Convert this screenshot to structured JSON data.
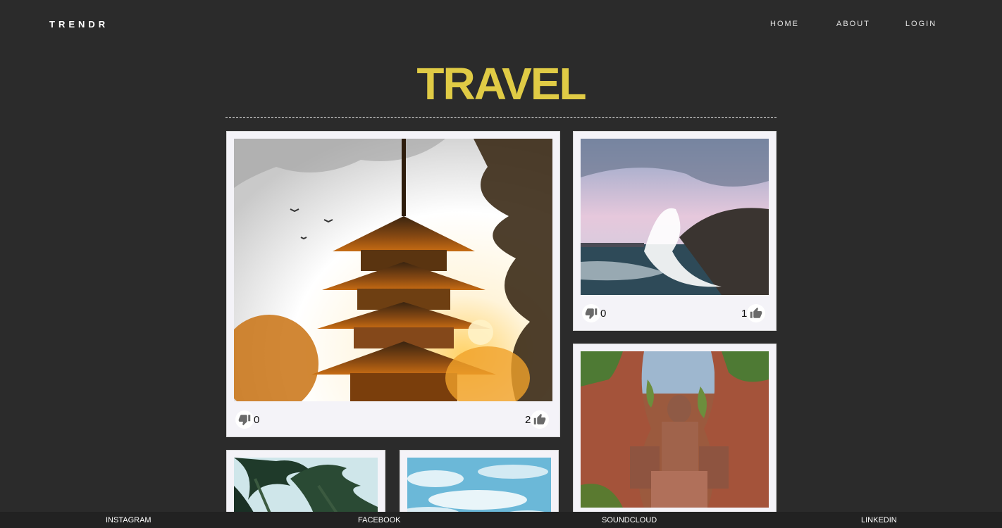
{
  "nav": {
    "brand": "TRENDR",
    "links": [
      "HOME",
      "ABOUT",
      "LOGIN"
    ]
  },
  "page": {
    "title": "TRAVEL"
  },
  "posts": [
    {
      "subject": "pagoda at sunset",
      "dislikes": "0",
      "likes": "2"
    },
    {
      "subject": "wave crashing on cliffs",
      "dislikes": "0",
      "likes": "1"
    },
    {
      "subject": "giant buddha carved in cliff"
    },
    {
      "subject": "palm trees"
    },
    {
      "subject": "blue sky with clouds"
    }
  ],
  "footer": {
    "links": [
      "INSTAGRAM",
      "FACEBOOK",
      "SOUNDCLOUD",
      "LINKEDIN"
    ]
  },
  "colors": {
    "background": "#2b2b2b",
    "accent": "#e0cb45",
    "card": "#f4f3f8"
  }
}
